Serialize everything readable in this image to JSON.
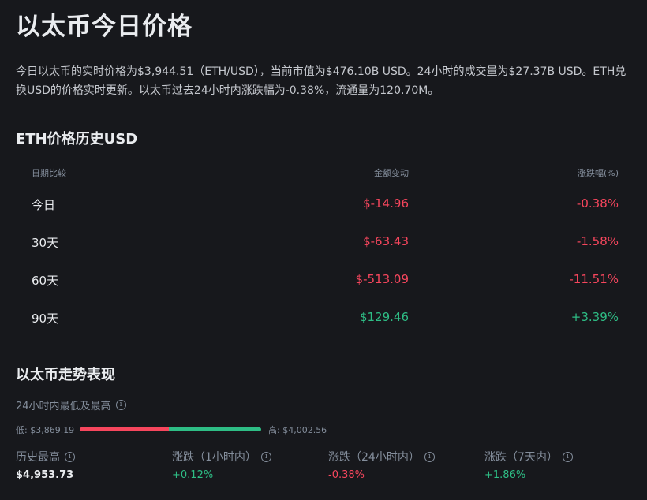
{
  "title": "以太币今日价格",
  "intro": "今日以太币的实时价格为$3,944.51（ETH/USD），当前市值为$476.10B USD。24小时的成交量为$27.37B USD。ETH兑换USD的价格实时更新。以太币过去24小时内涨跌幅为-0.38%，流通量为120.70M。",
  "history": {
    "title": "ETH价格历史USD",
    "headers": {
      "period": "日期比较",
      "change": "金额变动",
      "pct": "涨跌幅(%)"
    },
    "rows": [
      {
        "period": "今日",
        "change": "$-14.96",
        "pct": "-0.38%",
        "trend": "neg"
      },
      {
        "period": "30天",
        "change": "$-63.43",
        "pct": "-1.58%",
        "trend": "neg"
      },
      {
        "period": "60天",
        "change": "$-513.09",
        "pct": "-11.51%",
        "trend": "neg"
      },
      {
        "period": "90天",
        "change": "$129.46",
        "pct": "+3.39%",
        "trend": "pos"
      }
    ]
  },
  "performance": {
    "title": "以太币走势表现",
    "range": {
      "label": "24小时内最低及最高",
      "low_label": "低: $3,869.19",
      "high_label": "高: $4,002.56",
      "low_value": 3869.19,
      "high_value": 4002.56,
      "bar_split_fraction": 0.49
    },
    "stats": [
      {
        "label": "历史最高",
        "value": "$4,953.73",
        "trend": "plain"
      },
      {
        "label": "涨跌（1小时内）",
        "value": "+0.12%",
        "trend": "pos"
      },
      {
        "label": "涨跌（24小时内）",
        "value": "-0.38%",
        "trend": "neg"
      },
      {
        "label": "涨跌（7天内）",
        "value": "+1.86%",
        "trend": "pos"
      }
    ],
    "info_icon_glyph": "i"
  },
  "colors": {
    "background": "#17181c",
    "negative": "#f6465d",
    "positive": "#2ebd85",
    "muted": "#848e9c"
  }
}
